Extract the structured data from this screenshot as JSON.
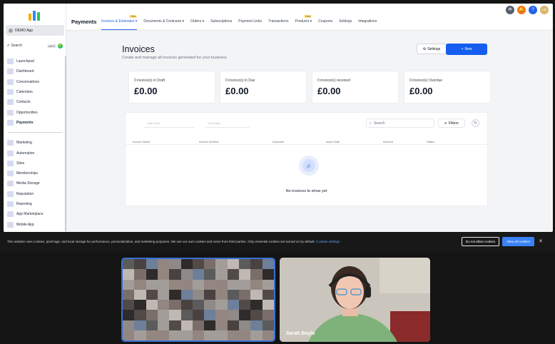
{
  "sidebar": {
    "account": "DEMO App",
    "search_label": "Search",
    "search_shortcut": "ctrl K",
    "items_top": [
      {
        "label": "Launchpad",
        "active": false
      },
      {
        "label": "Dashboard",
        "active": false
      },
      {
        "label": "Conversations",
        "active": false
      },
      {
        "label": "Calendars",
        "active": false
      },
      {
        "label": "Contacts",
        "active": false
      },
      {
        "label": "Opportunities",
        "active": false
      },
      {
        "label": "Payments",
        "active": true
      }
    ],
    "items_bottom": [
      {
        "label": "Marketing"
      },
      {
        "label": "Automation"
      },
      {
        "label": "Sites"
      },
      {
        "label": "Memberships"
      },
      {
        "label": "Media Storage"
      },
      {
        "label": "Reputation"
      },
      {
        "label": "Reporting"
      },
      {
        "label": "App Marketplace"
      },
      {
        "label": "Mobile App"
      }
    ]
  },
  "topbar": {
    "title": "Payments",
    "tabs": [
      {
        "label": "Invoices & Estimates",
        "active": true,
        "badge": "New",
        "dropdown": true
      },
      {
        "label": "Documents & Contracts",
        "active": false,
        "badge": "",
        "dropdown": true
      },
      {
        "label": "Orders",
        "active": false,
        "badge": "",
        "dropdown": true
      },
      {
        "label": "Subscriptions",
        "active": false,
        "badge": "",
        "dropdown": false
      },
      {
        "label": "Payment Links",
        "active": false,
        "badge": "",
        "dropdown": false
      },
      {
        "label": "Transactions",
        "active": false,
        "badge": "",
        "dropdown": false
      },
      {
        "label": "Products",
        "active": false,
        "badge": "New",
        "dropdown": true
      },
      {
        "label": "Coupons",
        "active": false,
        "badge": "",
        "dropdown": false
      },
      {
        "label": "Settings",
        "active": false,
        "badge": "",
        "dropdown": false
      },
      {
        "label": "Integrations",
        "active": false,
        "badge": "",
        "dropdown": false
      }
    ],
    "avatar_initials": "LB",
    "colors": {
      "accent": "#2563eb",
      "primary_button": "#155eef"
    }
  },
  "main": {
    "title": "Invoices",
    "subtitle": "Create and manage all invoices generated for your business",
    "settings_label": "Settings",
    "new_label": "New",
    "cards": [
      {
        "label": "0 invoice(s) in Draft",
        "amount": "£0.00"
      },
      {
        "label": "0 invoice(s) in Due",
        "amount": "£0.00"
      },
      {
        "label": "0 invoice(s) received",
        "amount": "£0.00"
      },
      {
        "label": "0 invoice(s) Overdue",
        "amount": "£0.00"
      }
    ],
    "start_date_placeholder": "Start Date",
    "end_date_placeholder": "End Date",
    "search_placeholder": "Search",
    "filters_label": "Filters",
    "columns": [
      "Invoice Name",
      "Invoice Number",
      "Customer",
      "Issue Date",
      "Amount",
      "Status"
    ],
    "empty_text": "No invoices to show yet"
  },
  "cookie": {
    "text": "This website uses cookies, pixel tags, and local storage for performance, personalization, and marketing purposes. We use our own cookies and some from third parties. Only essential cookies are turned on by default.",
    "link": "Cookies settings",
    "decline": "Do not allow cookies",
    "accept": "Allow all cookies"
  },
  "video": {
    "participant_name": "Sarah Boyle"
  }
}
